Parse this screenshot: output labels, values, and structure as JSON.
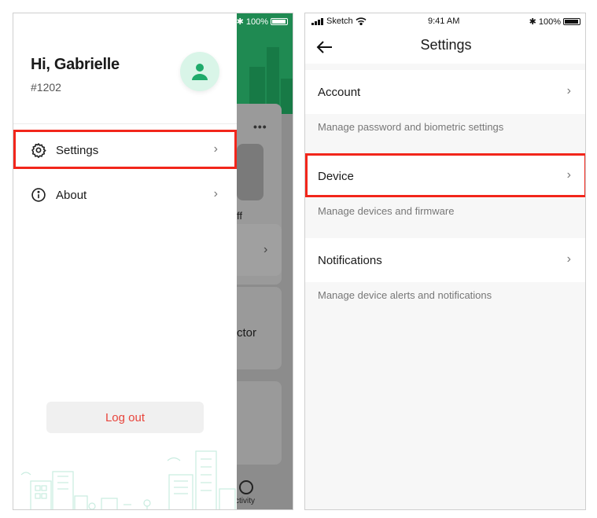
{
  "left_screen": {
    "background_app": {
      "status_battery": "100%",
      "dots": "•••",
      "partial_text_1": "ff",
      "partial_text_2": "ctor",
      "tab_label": "ctivity"
    },
    "drawer": {
      "greeting": "Hi, Gabrielle",
      "user_id": "#1202",
      "menu": [
        {
          "label": "Settings",
          "icon": "gear-icon"
        },
        {
          "label": "About",
          "icon": "info-icon"
        }
      ],
      "logout_label": "Log out",
      "colors": {
        "accent": "#1f8a52",
        "avatar_bg": "#d9f5e8",
        "logout_text": "#e8453c",
        "highlight": "#f2261b"
      }
    }
  },
  "right_screen": {
    "status": {
      "carrier": "Sketch",
      "time": "9:41 AM",
      "battery": "100%"
    },
    "title": "Settings",
    "sections": [
      {
        "label": "Account",
        "description": "Manage password and biometric settings"
      },
      {
        "label": "Device",
        "description": "Manage devices and firmware"
      },
      {
        "label": "Notifications",
        "description": "Manage device alerts and notifications"
      }
    ]
  }
}
